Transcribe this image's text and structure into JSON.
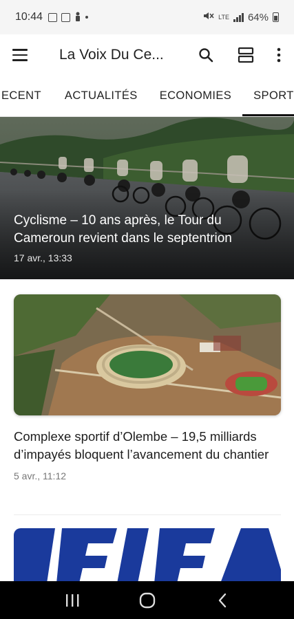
{
  "status_bar": {
    "time": "10:44",
    "network": "LTE",
    "battery": "64%"
  },
  "app_bar": {
    "title": "La Voix Du Ce...",
    "icons": [
      "menu-icon",
      "search-icon",
      "view-toggle-icon",
      "more-vert-icon"
    ]
  },
  "tabs": [
    {
      "label": "ECENT",
      "active": false
    },
    {
      "label": "ACTUALITÉS",
      "active": false
    },
    {
      "label": "ECONOMIES",
      "active": false
    },
    {
      "label": "SPORTS",
      "active": true
    }
  ],
  "articles": [
    {
      "title": "Cyclisme – 10 ans après, le Tour du Cameroun revient dans le septentrion",
      "date": "17 avr., 13:33"
    },
    {
      "title": "Complexe sportif d’Olembe – 19,5 milliards d’impayés bloquent l’avancement du chantier",
      "date": "5 avr., 11:12"
    }
  ],
  "nav_bar": {
    "icons": [
      "recents-icon",
      "home-icon",
      "back-icon"
    ]
  },
  "colors": {
    "status_bar_bg": "#f5f5f5",
    "nav_bar_bg": "#000000",
    "active_tab_indicator": "#111111",
    "fifa_blue": "#1a3a9c"
  }
}
